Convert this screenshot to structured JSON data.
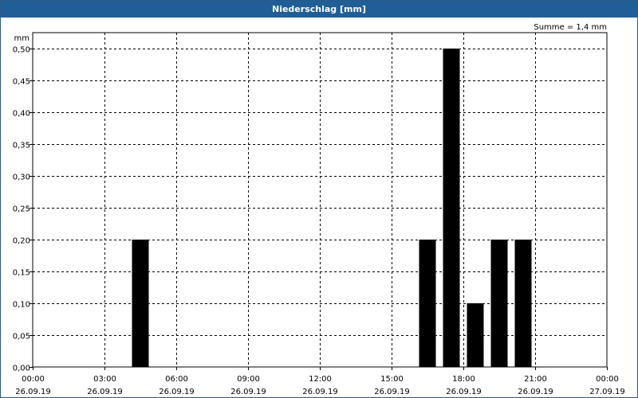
{
  "window": {
    "title": "Niederschlag [mm]"
  },
  "chart_data": {
    "type": "bar",
    "title": "Niederschlag [mm]",
    "ylabel": "mm",
    "xlabel": "",
    "annotation": "Summe = 1,4 mm",
    "ylim": [
      0,
      0.5
    ],
    "xlim_hours": [
      0,
      24
    ],
    "grid": true,
    "bar_color": "#000000",
    "y_ticks": [
      {
        "value": 0.0,
        "label": "0,00"
      },
      {
        "value": 0.05,
        "label": "0,05"
      },
      {
        "value": 0.1,
        "label": "0,10"
      },
      {
        "value": 0.15,
        "label": "0,15"
      },
      {
        "value": 0.2,
        "label": "0,20"
      },
      {
        "value": 0.25,
        "label": "0,25"
      },
      {
        "value": 0.3,
        "label": "0,30"
      },
      {
        "value": 0.35,
        "label": "0,35"
      },
      {
        "value": 0.4,
        "label": "0,40"
      },
      {
        "value": 0.45,
        "label": "0,45"
      },
      {
        "value": 0.5,
        "label": "0,50"
      }
    ],
    "x_ticks": [
      {
        "hour": 0,
        "time": "00:00",
        "date": "26.09.19"
      },
      {
        "hour": 3,
        "time": "03:00",
        "date": "26.09.19"
      },
      {
        "hour": 6,
        "time": "06:00",
        "date": "26.09.19"
      },
      {
        "hour": 9,
        "time": "09:00",
        "date": "26.09.19"
      },
      {
        "hour": 12,
        "time": "12:00",
        "date": "26.09.19"
      },
      {
        "hour": 15,
        "time": "15:00",
        "date": "26.09.19"
      },
      {
        "hour": 18,
        "time": "18:00",
        "date": "26.09.19"
      },
      {
        "hour": 21,
        "time": "21:00",
        "date": "26.09.19"
      },
      {
        "hour": 24,
        "time": "00:00",
        "date": "27.09.19"
      }
    ],
    "bars": [
      {
        "hour": 4,
        "value": 0.2
      },
      {
        "hour": 16,
        "value": 0.2
      },
      {
        "hour": 17,
        "value": 0.5
      },
      {
        "hour": 18,
        "value": 0.1
      },
      {
        "hour": 19,
        "value": 0.2
      },
      {
        "hour": 20,
        "value": 0.2
      }
    ]
  }
}
